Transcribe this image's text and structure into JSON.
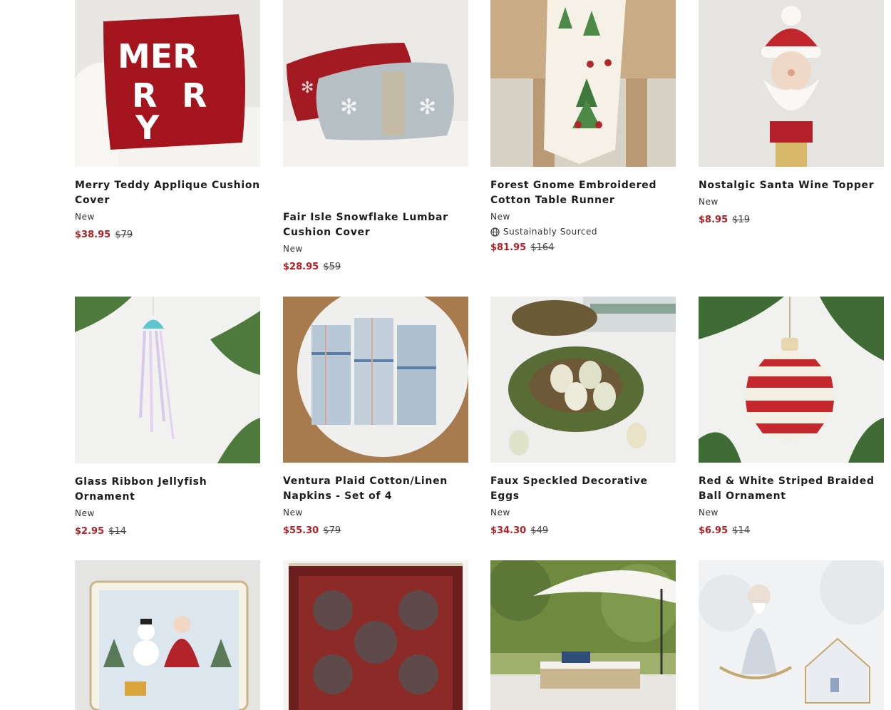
{
  "products": [
    {
      "title": "Merry Teddy Applique Cushion Cover",
      "badge": "New",
      "sale_price": "$38.95",
      "original_price": "$79",
      "image": "red-merry-pillow-on-white-sofa"
    },
    {
      "title": "Fair Isle Snowflake Lumbar Cushion Cover",
      "badge": "New",
      "sale_price": "$28.95",
      "original_price": "$59",
      "image": "fair-isle-lumbar-pillows"
    },
    {
      "title": "Forest Gnome Embroidered Cotton Table Runner",
      "badge": "New",
      "sustainability": "Sustainably Sourced",
      "sale_price": "$81.95",
      "original_price": "$164",
      "image": "gnome-table-runner"
    },
    {
      "title": "Nostalgic Santa Wine Topper",
      "badge": "New",
      "sale_price": "$8.95",
      "original_price": "$19",
      "image": "santa-wine-topper"
    },
    {
      "title": "Glass Ribbon Jellyfish Ornament",
      "badge": "New",
      "sale_price": "$2.95",
      "original_price": "$14",
      "image": "jellyfish-ornament"
    },
    {
      "title": "Ventura Plaid Cotton/Linen Napkins - Set of 4",
      "badge": "New",
      "sale_price": "$55.30",
      "original_price": "$79",
      "image": "plaid-napkins"
    },
    {
      "title": "Faux Speckled Decorative Eggs",
      "badge": "New",
      "sale_price": "$34.30",
      "original_price": "$49",
      "image": "speckled-eggs-nest"
    },
    {
      "title": "Red & White Striped Braided Ball Ornament",
      "badge": "New",
      "sale_price": "$6.95",
      "original_price": "$14",
      "image": "striped-ball-ornament"
    },
    {
      "image": "santa-snowman-platter"
    },
    {
      "image": "red-persian-rug"
    },
    {
      "image": "patio-umbrella-lounger"
    },
    {
      "image": "snowy-santa-figurines"
    }
  ],
  "colors": {
    "sale": "#b21f24",
    "text": "#1d1d1d"
  },
  "icons": {
    "sustainability": "globe-icon"
  }
}
